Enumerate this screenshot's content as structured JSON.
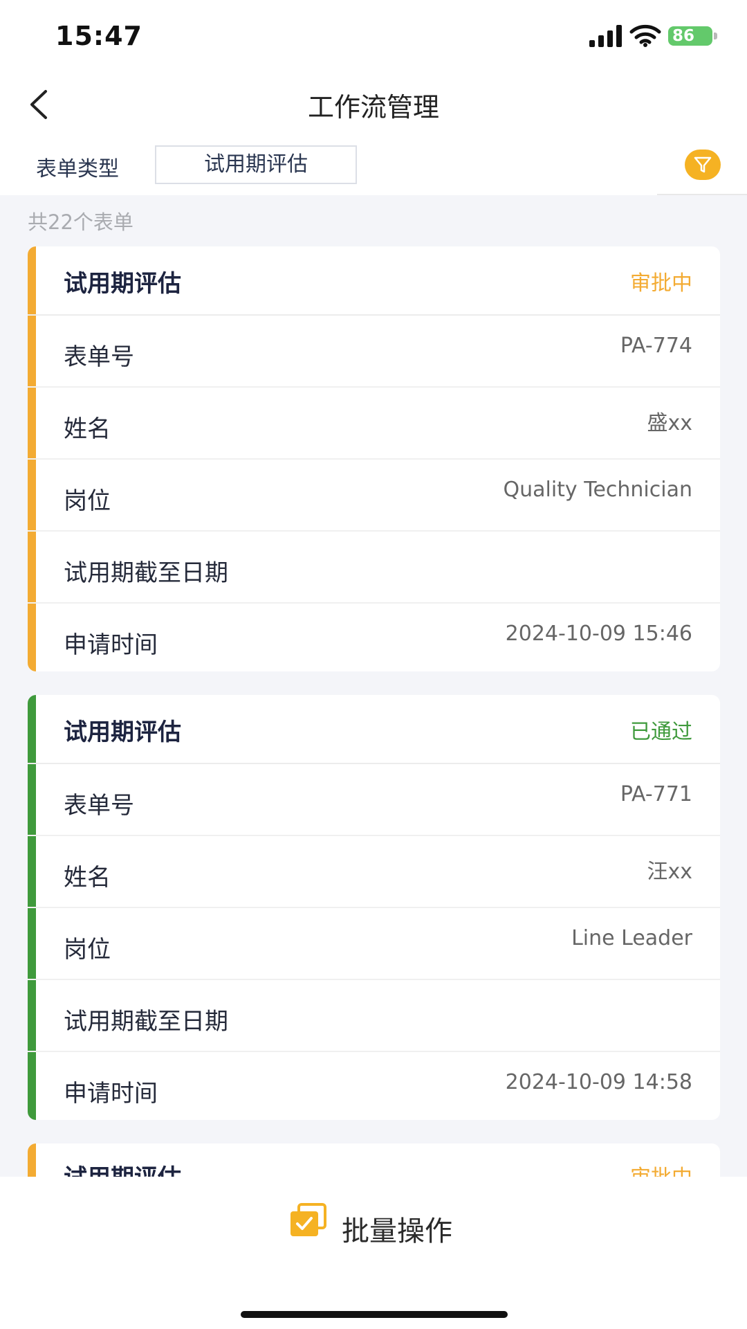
{
  "status_bar": {
    "time": "15:47",
    "battery": "86"
  },
  "nav": {
    "title": "工作流管理"
  },
  "filter": {
    "label": "表单类型",
    "selected": "试用期评估"
  },
  "summary": {
    "count_text": "共22个表单"
  },
  "colors": {
    "pending": "#f3ab33",
    "approved": "#3f9a3c",
    "filter_button": "#f5b223"
  },
  "cards": [
    {
      "title": "试用期评估",
      "status": "审批中",
      "fields": [
        {
          "label": "表单号",
          "value": "PA-774"
        },
        {
          "label": "姓名",
          "value": "盛xx"
        },
        {
          "label": "岗位",
          "value": "Quality Technician"
        },
        {
          "label": "试用期截至日期",
          "value": ""
        },
        {
          "label": "申请时间",
          "value": "2024-10-09 15:46"
        }
      ]
    },
    {
      "title": "试用期评估",
      "status": "已通过",
      "fields": [
        {
          "label": "表单号",
          "value": "PA-771"
        },
        {
          "label": "姓名",
          "value": "汪xx"
        },
        {
          "label": "岗位",
          "value": "Line Leader"
        },
        {
          "label": "试用期截至日期",
          "value": ""
        },
        {
          "label": "申请时间",
          "value": "2024-10-09 14:58"
        }
      ]
    },
    {
      "title": "试用期评估",
      "status": "审批中"
    }
  ],
  "bottom": {
    "batch_label": "批量操作"
  }
}
